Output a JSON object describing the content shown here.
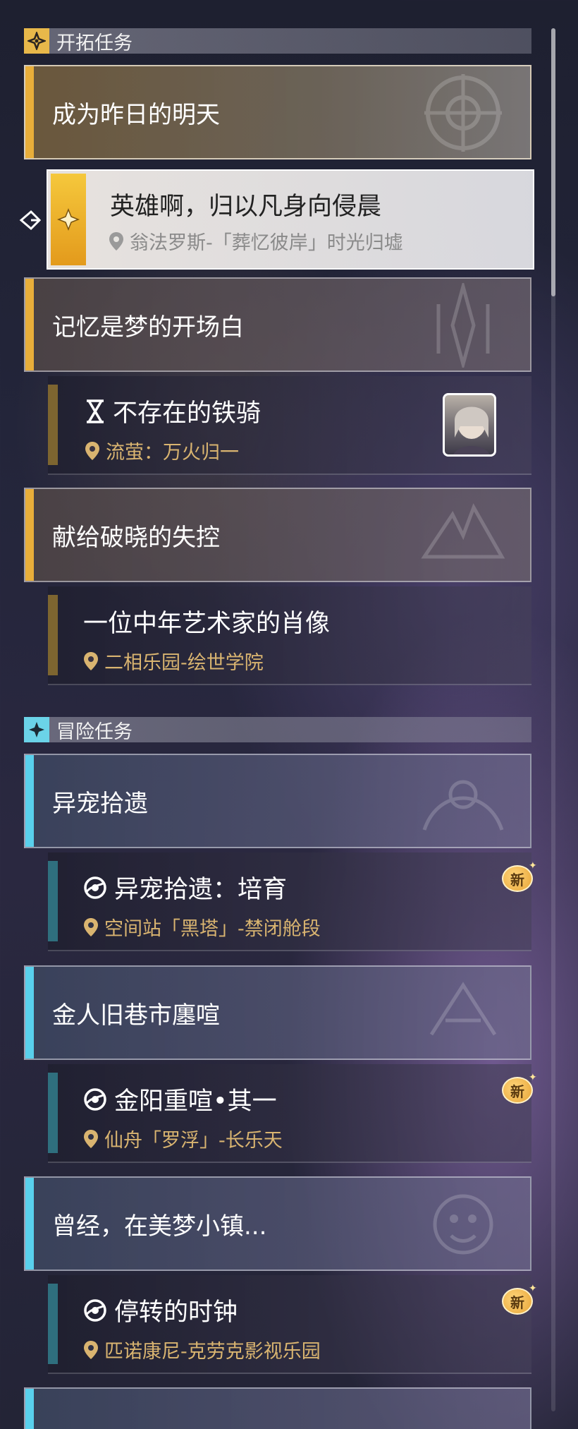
{
  "sections": [
    {
      "title": "开拓任务",
      "icon": "trailblaze-mission-icon",
      "accent": "#e8b84a",
      "groups": [
        {
          "title": "成为昨日的明天",
          "quests": [
            {
              "title": "英雄啊，归以凡身向侵晨",
              "location": "翁法罗斯-「葬忆彼岸」时光归墟",
              "selected": true
            }
          ]
        },
        {
          "title": "记忆是梦的开场白",
          "quests": [
            {
              "title": "不存在的铁骑",
              "location": "流萤：万火归一",
              "icon": "hourglass-icon",
              "has_avatar": true
            }
          ]
        },
        {
          "title": "献给破晓的失控",
          "quests": [
            {
              "title": "一位中年艺术家的肖像",
              "location": "二相乐园-绘世学院"
            }
          ]
        }
      ]
    },
    {
      "title": "冒险任务",
      "icon": "adventure-mission-icon",
      "accent": "#6bd3e8",
      "groups": [
        {
          "title": "异宠拾遗",
          "quests": [
            {
              "title": "异宠拾遗：培育",
              "location": "空间站「黑塔」-禁闭舱段",
              "icon": "adventure-quest-icon",
              "badge": "新"
            }
          ]
        },
        {
          "title": "金人旧巷市廛喧",
          "quests": [
            {
              "title": "金阳重喧•其一",
              "location": "仙舟「罗浮」-长乐天",
              "icon": "adventure-quest-icon",
              "badge": "新"
            }
          ]
        },
        {
          "title": "曾经，在美梦小镇...",
          "quests": [
            {
              "title": "停转的时钟",
              "location": "匹诺康尼-克劳克影视乐园",
              "icon": "adventure-quest-icon",
              "badge": "新"
            }
          ]
        }
      ]
    }
  ]
}
